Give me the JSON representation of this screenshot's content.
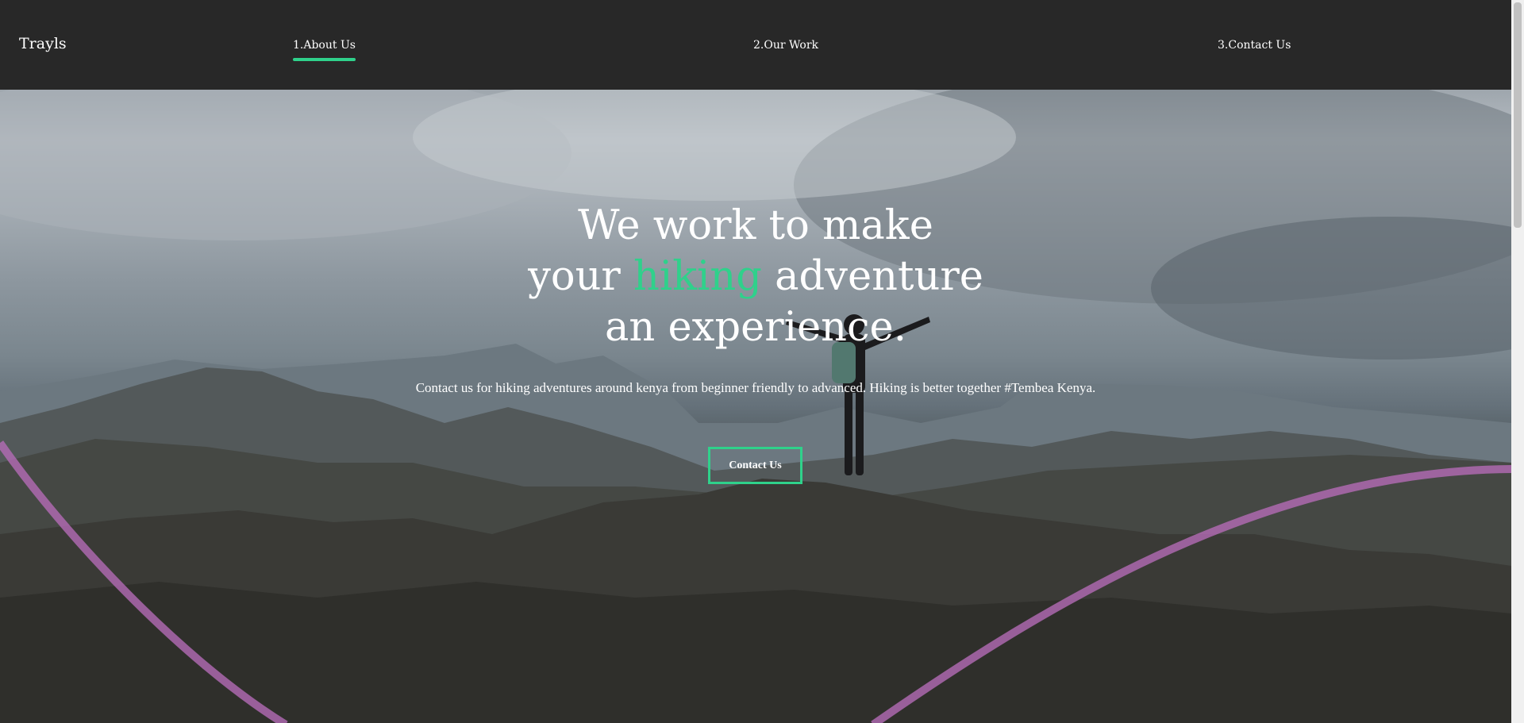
{
  "brand": {
    "logo": "Trayls"
  },
  "nav": {
    "items": [
      {
        "label": "1.About Us",
        "active": true
      },
      {
        "label": "2.Our Work",
        "active": false
      },
      {
        "label": "3.Contact Us",
        "active": false
      }
    ]
  },
  "hero": {
    "headline_line1": "We work to make",
    "headline_line2_pre": "your ",
    "headline_highlight": "hiking",
    "headline_line2_post": " adventure",
    "headline_line3": "an experience.",
    "subtext": "Contact us for hiking adventures around kenya from beginner friendly to advanced. Hiking is better together #Tembea Kenya.",
    "cta_label": "Contact Us"
  },
  "colors": {
    "accent": "#2fd18b",
    "nav_bg": "#282828",
    "curve": "#b46bb6"
  }
}
